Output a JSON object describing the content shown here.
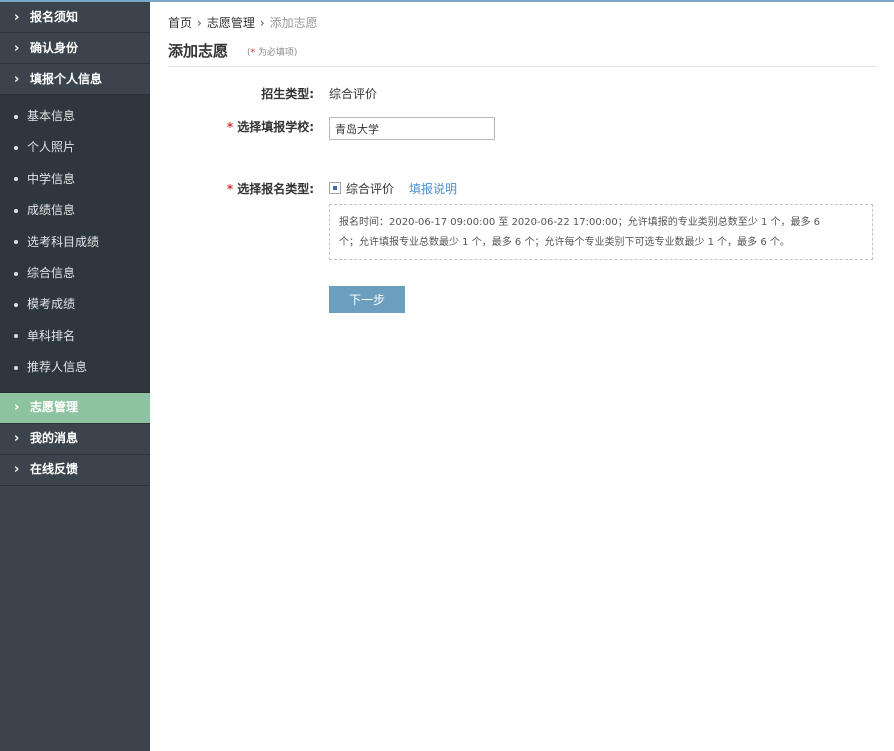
{
  "sidebar": {
    "top_items": [
      {
        "label": "报名须知"
      },
      {
        "label": "确认身份"
      },
      {
        "label": "填报个人信息"
      }
    ],
    "sub_items": [
      {
        "label": "基本信息"
      },
      {
        "label": "个人照片"
      },
      {
        "label": "中学信息"
      },
      {
        "label": "成绩信息"
      },
      {
        "label": "选考科目成绩"
      },
      {
        "label": "综合信息"
      },
      {
        "label": "模考成绩"
      },
      {
        "label": "单科排名"
      },
      {
        "label": "推荐人信息"
      }
    ],
    "bottom_items": [
      {
        "label": "志愿管理",
        "active": true
      },
      {
        "label": "我的消息"
      },
      {
        "label": "在线反馈"
      }
    ]
  },
  "breadcrumb": {
    "home": "首页",
    "section": "志愿管理",
    "current": "添加志愿",
    "separator": "›"
  },
  "page": {
    "title": "添加志愿",
    "required_star": "*",
    "required_note": "为必填项"
  },
  "form": {
    "admission_type_label": "招生类型:",
    "admission_type_value": "综合评价",
    "school_label": "选择填报学校:",
    "school_value": "青岛大学",
    "apply_type_label": "选择报名类型:",
    "apply_type_option": "综合评价",
    "help_link": "填报说明",
    "star": "*",
    "notice_line1": "报名时间：2020-06-17 09:00:00 至 2020-06-22 17:00:00；允许填报的专业类别总数至少 1 个，最多 6",
    "notice_line2": "个；允许填报专业总数最少 1 个，最多 6 个；允许每个专业类别下可选专业数最少 1 个，最多 6 个。",
    "next_button": "下一步"
  },
  "colors": {
    "sidebar_bg": "#3b444c",
    "active_item": "#8dc3a1",
    "button": "#6c9fbe",
    "link": "#4a8fd0",
    "required": "#d33333"
  }
}
